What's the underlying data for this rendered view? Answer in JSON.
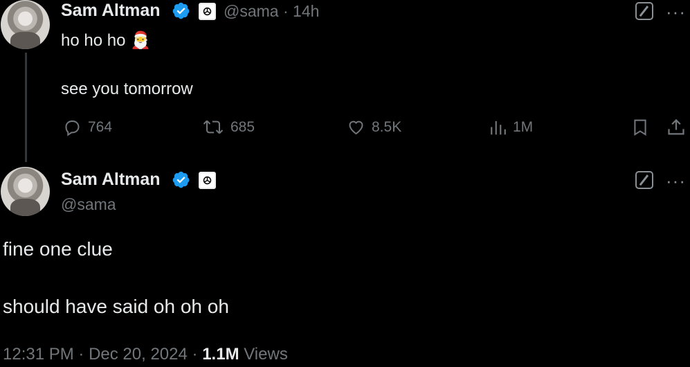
{
  "tweet1": {
    "name": "Sam Altman",
    "handle": "@sama",
    "separator": "·",
    "time": "14h",
    "line1": "ho ho ho",
    "emoji": "🎅",
    "line2": "see you tomorrow",
    "stats": {
      "replies": "764",
      "reposts": "685",
      "likes": "8.5K",
      "views": "1M"
    }
  },
  "tweet2": {
    "name": "Sam Altman",
    "handle": "@sama",
    "line1": "fine one clue",
    "line2": "should have said oh oh oh",
    "footer": {
      "time": "12:31 PM",
      "sep1": "·",
      "date": "Dec 20, 2024",
      "sep2": "·",
      "views_count": "1.1M",
      "views_label": "Views"
    }
  },
  "icons": {
    "verified": "verified-badge-icon",
    "org": "openai-affiliate-icon",
    "grok": "grok-icon",
    "more": "more-icon",
    "reply": "reply-icon",
    "repost": "repost-icon",
    "like": "heart-icon",
    "views": "analytics-icon",
    "bookmark": "bookmark-icon",
    "share": "share-icon"
  },
  "colors": {
    "background": "#000000",
    "text": "#e7e9ea",
    "muted": "#71767b",
    "verified": "#1d9bf0"
  }
}
